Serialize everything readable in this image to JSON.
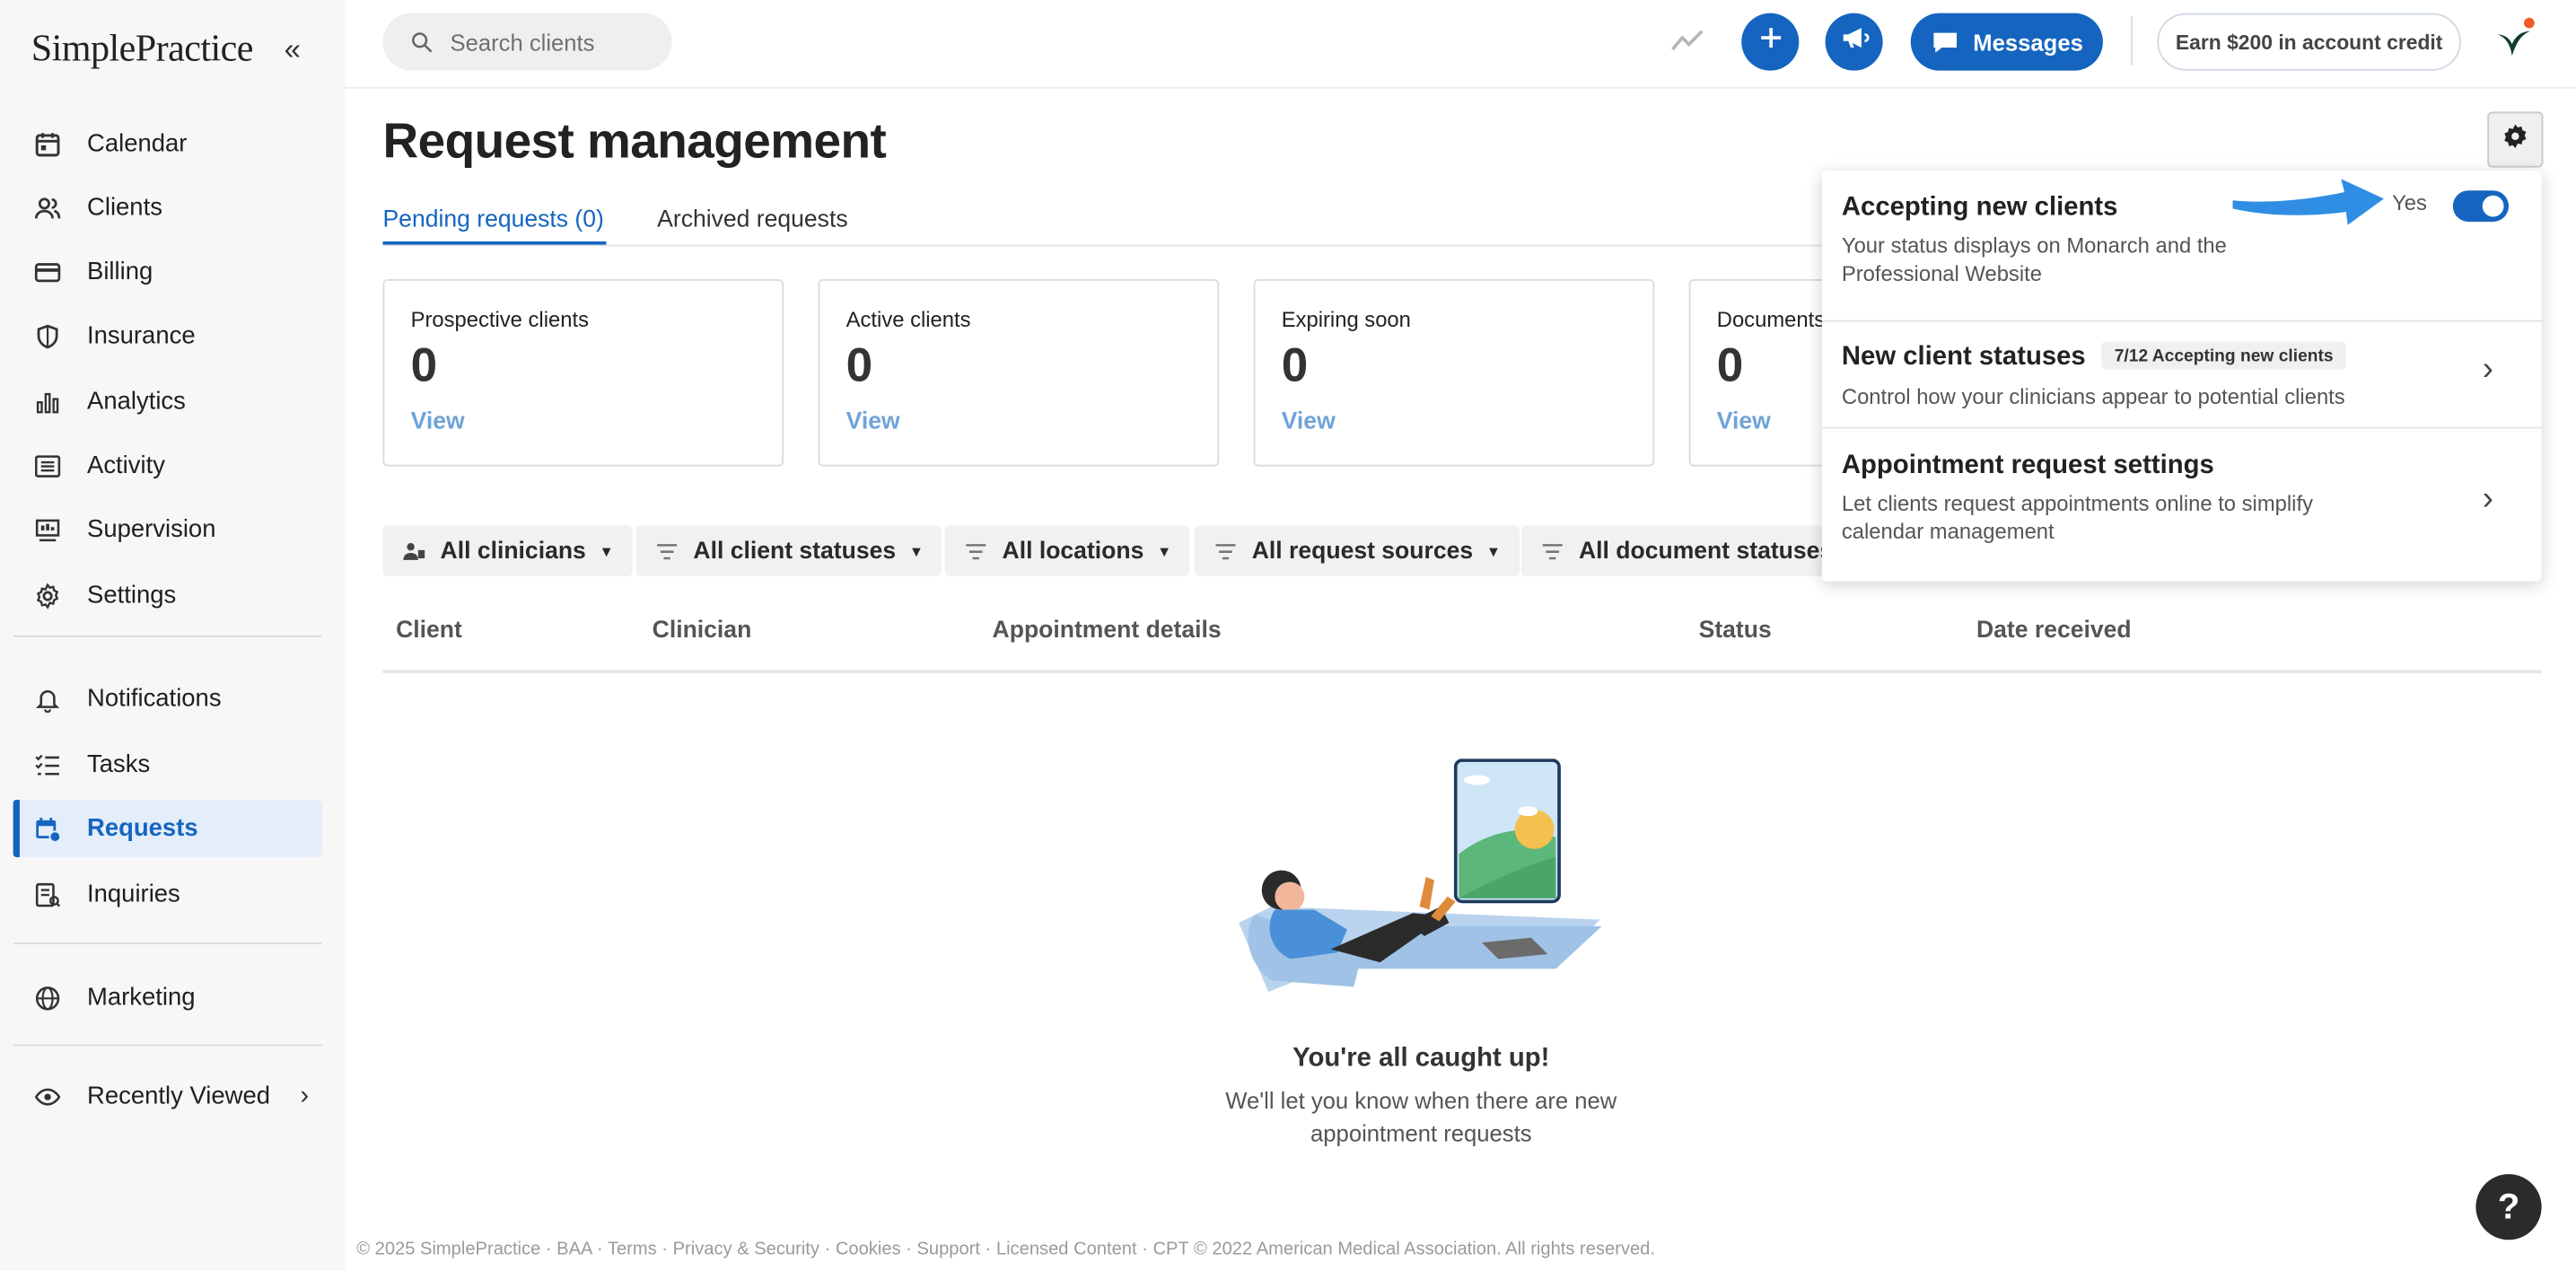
{
  "app": {
    "logo_text": "SimplePractice",
    "collapse_icon": "double-chevron-left-icon",
    "brand_color": "#1565c0"
  },
  "sidebar": {
    "items": [
      {
        "label": "Calendar",
        "icon": "calendar-icon"
      },
      {
        "label": "Clients",
        "icon": "clients-icon"
      },
      {
        "label": "Billing",
        "icon": "credit-card-icon"
      },
      {
        "label": "Insurance",
        "icon": "shield-icon"
      },
      {
        "label": "Analytics",
        "icon": "bar-chart-icon"
      },
      {
        "label": "Activity",
        "icon": "list-icon"
      },
      {
        "label": "Supervision",
        "icon": "supervision-icon"
      },
      {
        "label": "Settings",
        "icon": "gear-icon"
      }
    ],
    "items2": [
      {
        "label": "Notifications",
        "icon": "bell-icon"
      },
      {
        "label": "Tasks",
        "icon": "checklist-icon"
      },
      {
        "label": "Requests",
        "icon": "calendar-request-icon",
        "active": true
      },
      {
        "label": "Inquiries",
        "icon": "inquiries-icon"
      }
    ],
    "items3": [
      {
        "label": "Marketing",
        "icon": "globe-icon"
      }
    ],
    "recently_viewed": {
      "label": "Recently Viewed",
      "icon": "eye-icon"
    }
  },
  "topbar": {
    "search_placeholder": "Search clients",
    "messages_label": "Messages",
    "earn_label": "Earn $200 in account credit"
  },
  "main": {
    "title": "Request management",
    "tabs": [
      {
        "label": "Pending requests (0)",
        "active": true
      },
      {
        "label": "Archived requests"
      }
    ],
    "cards": [
      {
        "title": "Prospective clients",
        "count": "0",
        "link": "View"
      },
      {
        "title": "Active clients",
        "count": "0",
        "link": "View"
      },
      {
        "title": "Expiring soon",
        "count": "0",
        "link": "View"
      },
      {
        "title": "Documents",
        "count": "0",
        "link": "View"
      }
    ],
    "filters": [
      "All clinicians",
      "All client statuses",
      "All locations",
      "All request sources",
      "All document statuses"
    ],
    "columns": [
      "Client",
      "Clinician",
      "Appointment details",
      "Status",
      "Date received"
    ],
    "empty": {
      "title": "You're all caught up!",
      "subtitle_line1": "We'll let you know when there are new",
      "subtitle_line2": "appointment requests"
    }
  },
  "panel": {
    "accepting_title": "Accepting new clients",
    "accepting_sub_line1": "Your status displays on Monarch and the",
    "accepting_sub_line2": "Professional Website",
    "toggle_label": "Yes",
    "toggle_on": true,
    "statuses_title": "New client statuses",
    "statuses_badge": "7/12 Accepting new clients",
    "statuses_sub": "Control how your clinicians appear to potential clients",
    "appt_title": "Appointment request settings",
    "appt_sub_line1": "Let clients request appointments online to simplify",
    "appt_sub_line2": "calendar management"
  },
  "footer": {
    "text": "© 2025 SimplePractice · BAA · Terms · Privacy & Security · Cookies · Support · Licensed Content · CPT © 2022 American Medical Association. All rights reserved."
  },
  "help_label": "?"
}
